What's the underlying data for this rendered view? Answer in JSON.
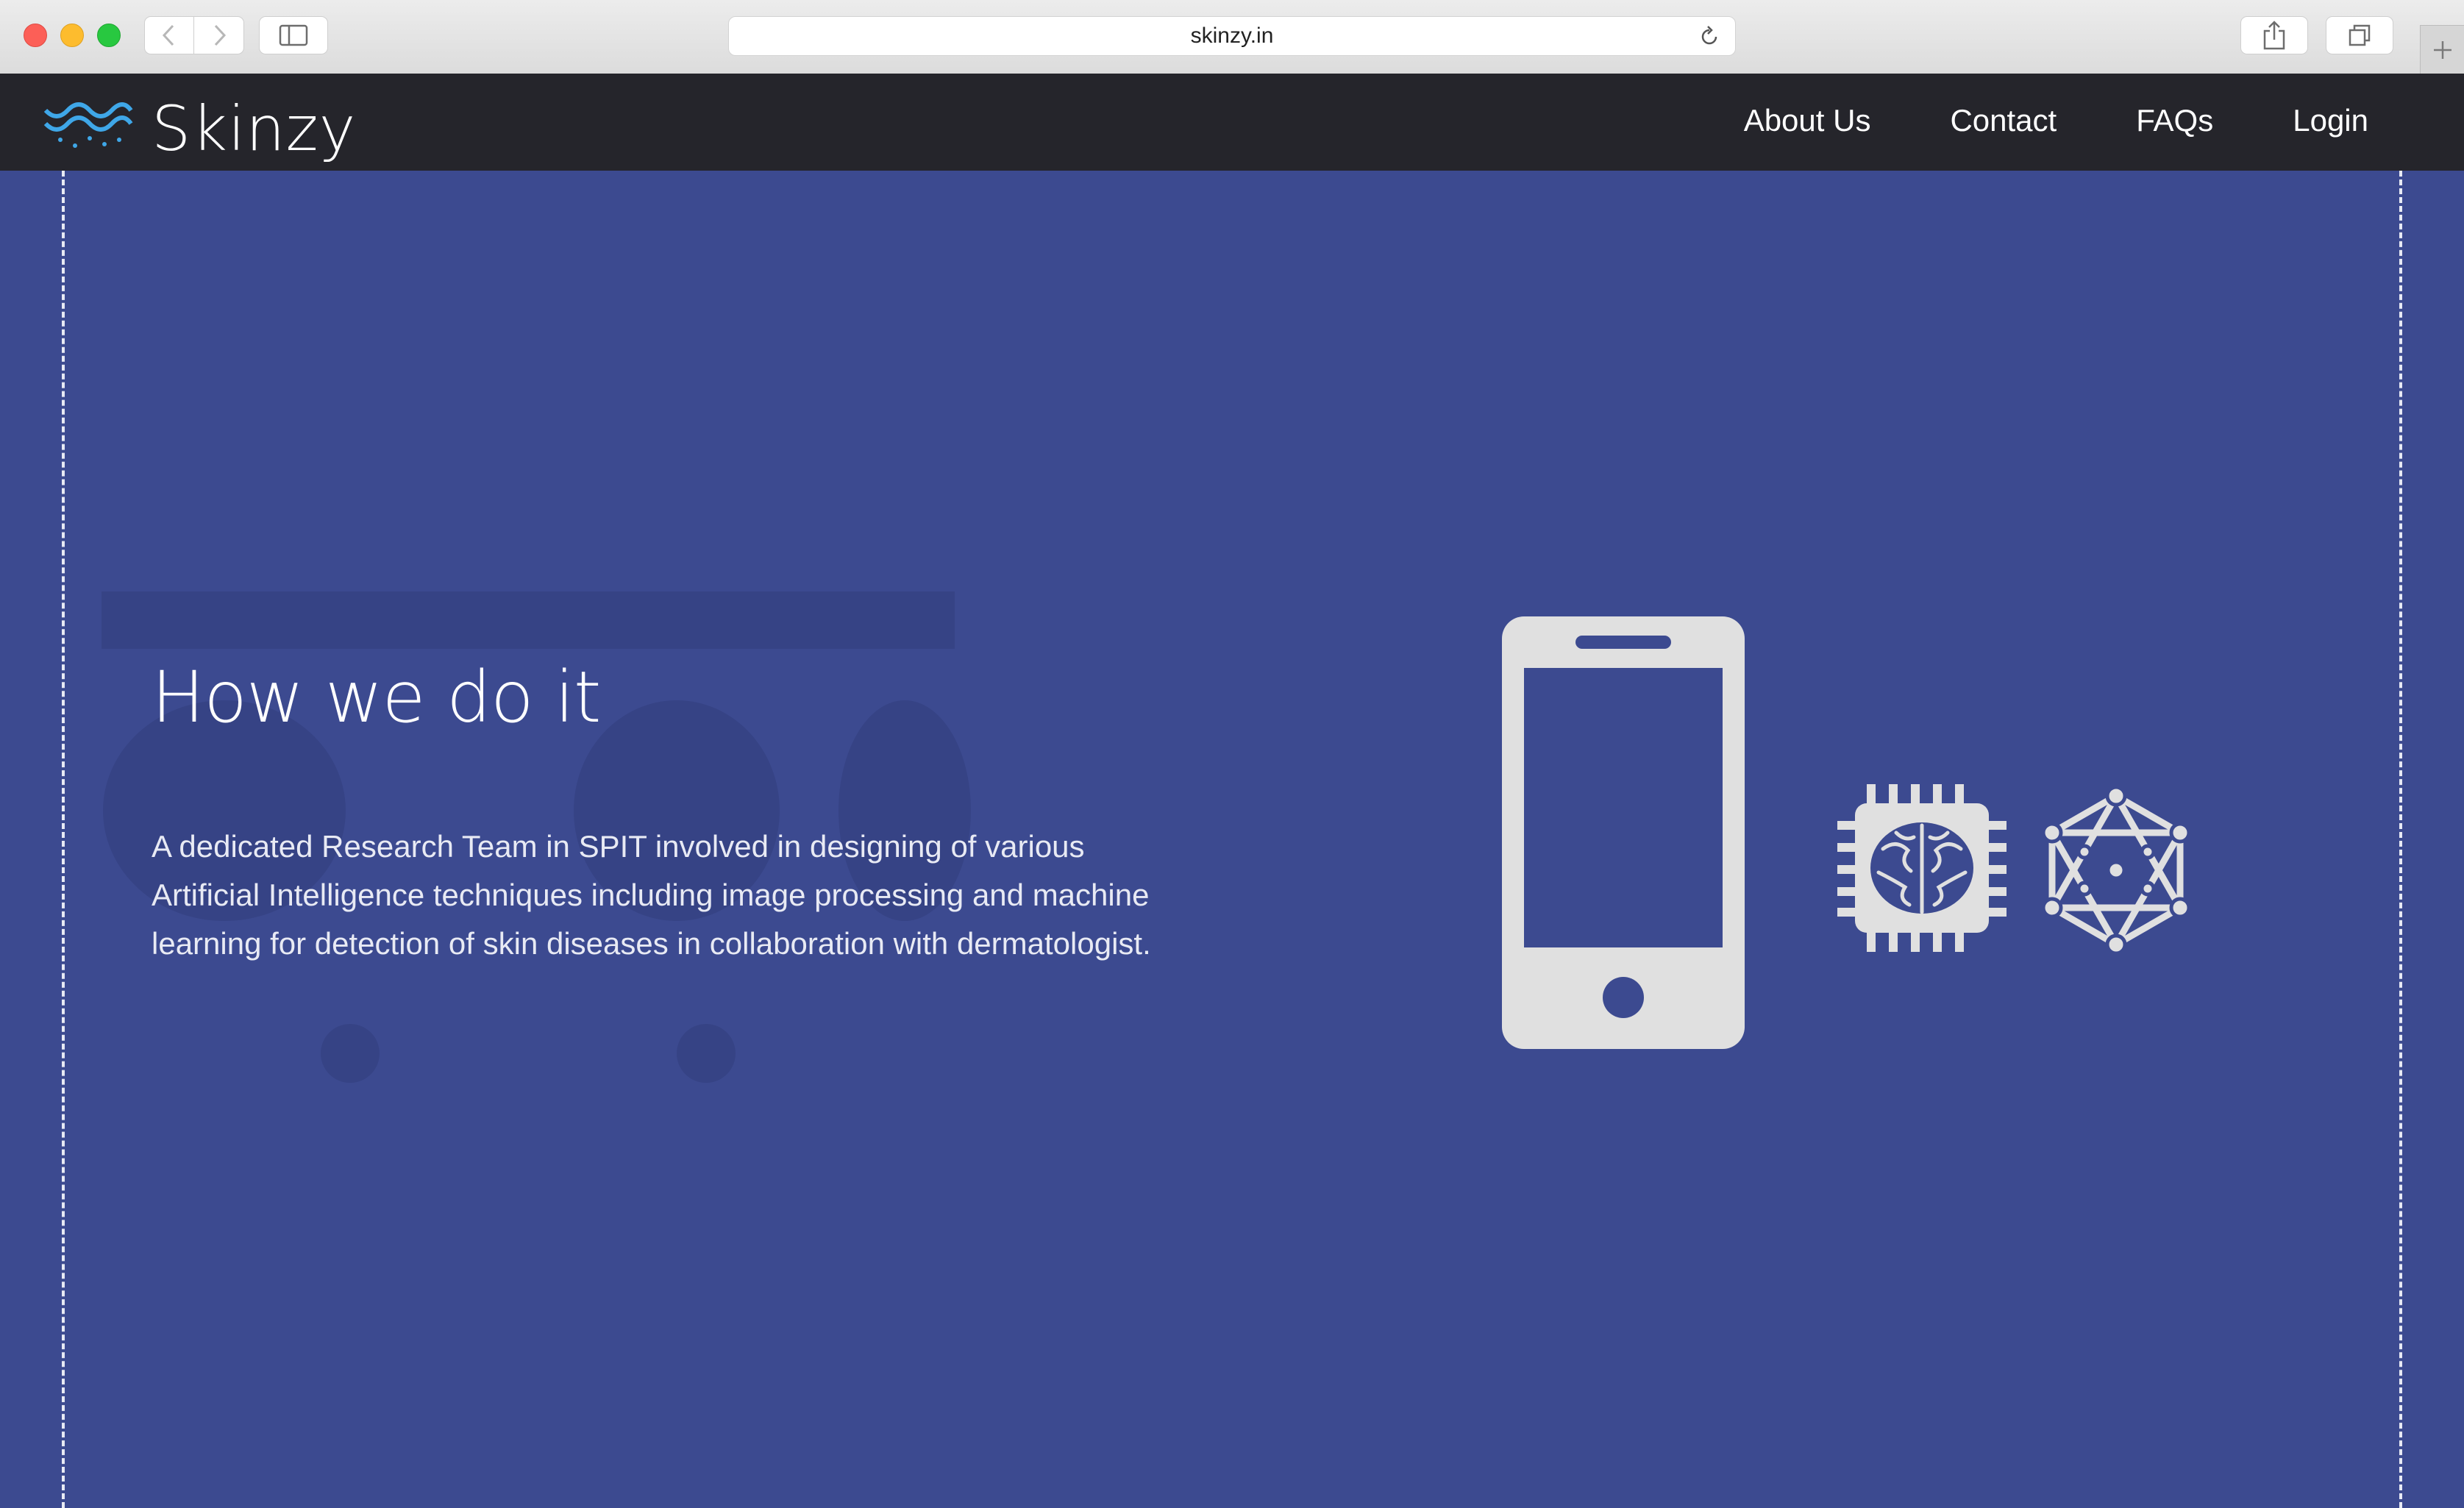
{
  "browser": {
    "url": "skinzy.in",
    "icons": {
      "back": "chevron-left-icon",
      "forward": "chevron-right-icon",
      "sidebar": "sidebar-icon",
      "reload": "reload-icon",
      "share": "share-icon",
      "tabs": "tabs-icon",
      "new_tab": "plus-icon"
    }
  },
  "site": {
    "brand": "Skinzy",
    "logo_icon": "wave-logo-icon",
    "nav": [
      "About Us",
      "Contact",
      "FAQs",
      "Login"
    ]
  },
  "hero": {
    "heading": "How we do it",
    "description": "A dedicated Research Team in SPIT involved in designing of various Artificial Intelligence techniques including image processing and machine learning for detection of skin diseases in collaboration with dermatologist.",
    "illustrations": [
      "smartphone-icon",
      "brain-chip-icon",
      "neural-network-icon"
    ]
  },
  "colors": {
    "hero_bg": "#3c4a90",
    "nav_bg": "#25252b",
    "icon_fill": "#e0e0e0",
    "logo_accent": "#3fa7e8"
  }
}
